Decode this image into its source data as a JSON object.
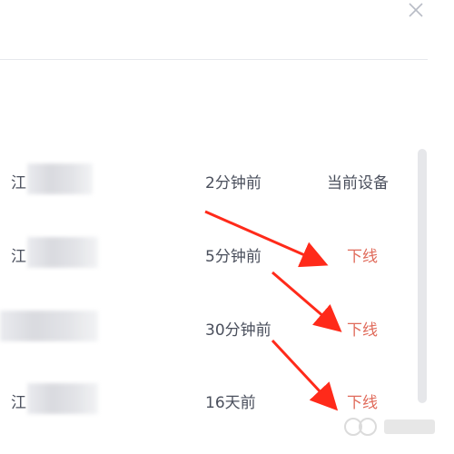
{
  "colors": {
    "accent_red": "#e06b5b",
    "text": "#4a4f5c",
    "divider": "#e6e8ec",
    "annotation_arrow": "#ff2a1a"
  },
  "dialog": {
    "close_icon": "close-icon"
  },
  "sessions": [
    {
      "device_prefix": "江",
      "time": "2分钟前",
      "action": "当前设备",
      "is_current": true
    },
    {
      "device_prefix": "江",
      "time": "5分钟前",
      "action": "下线",
      "is_current": false
    },
    {
      "device_prefix": "",
      "time": "30分钟前",
      "action": "下线",
      "is_current": false
    },
    {
      "device_prefix": "江",
      "time": "16天前",
      "action": "下线",
      "is_current": false
    }
  ]
}
